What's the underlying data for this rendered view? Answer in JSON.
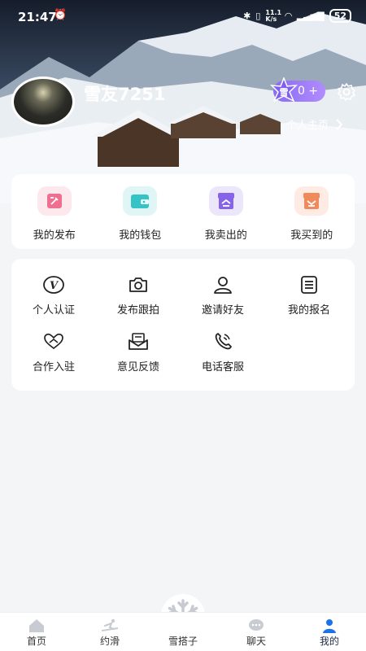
{
  "status_bar": {
    "time": "21:47",
    "network_speed": "11.1 K/s",
    "battery": "52"
  },
  "profile": {
    "nickname": "雪友7251",
    "vip_count": "0 +",
    "profile_link": "个人主页"
  },
  "quick_actions": [
    {
      "label": "我的发布",
      "icon": "edit-icon",
      "bg": "#fde8ee",
      "color": "#ee6e8e"
    },
    {
      "label": "我的钱包",
      "icon": "wallet-icon",
      "bg": "#dff5f6",
      "color": "#3cc6c8"
    },
    {
      "label": "我卖出的",
      "icon": "sold-icon",
      "bg": "#ece6fb",
      "color": "#8663e8"
    },
    {
      "label": "我买到的",
      "icon": "bought-icon",
      "bg": "#fdebe4",
      "color": "#f08a5b"
    }
  ],
  "services": [
    {
      "label": "个人认证",
      "icon": "verify-icon"
    },
    {
      "label": "发布跟拍",
      "icon": "camera-icon"
    },
    {
      "label": "邀请好友",
      "icon": "user-icon"
    },
    {
      "label": "我的报名",
      "icon": "list-icon"
    },
    {
      "label": "合作入驻",
      "icon": "handshake-icon"
    },
    {
      "label": "意见反馈",
      "icon": "feedback-icon"
    },
    {
      "label": "电话客服",
      "icon": "phone-icon"
    }
  ],
  "tabbar": [
    {
      "label": "首页",
      "icon": "home-icon"
    },
    {
      "label": "约滑",
      "icon": "ski-icon"
    },
    {
      "label": "雪搭子",
      "icon": "snowflake-icon"
    },
    {
      "label": "聊天",
      "icon": "chat-icon"
    },
    {
      "label": "我的",
      "icon": "person-icon"
    }
  ],
  "colors": {
    "accent": "#1a73e8",
    "vip": "#9b7bf7"
  }
}
